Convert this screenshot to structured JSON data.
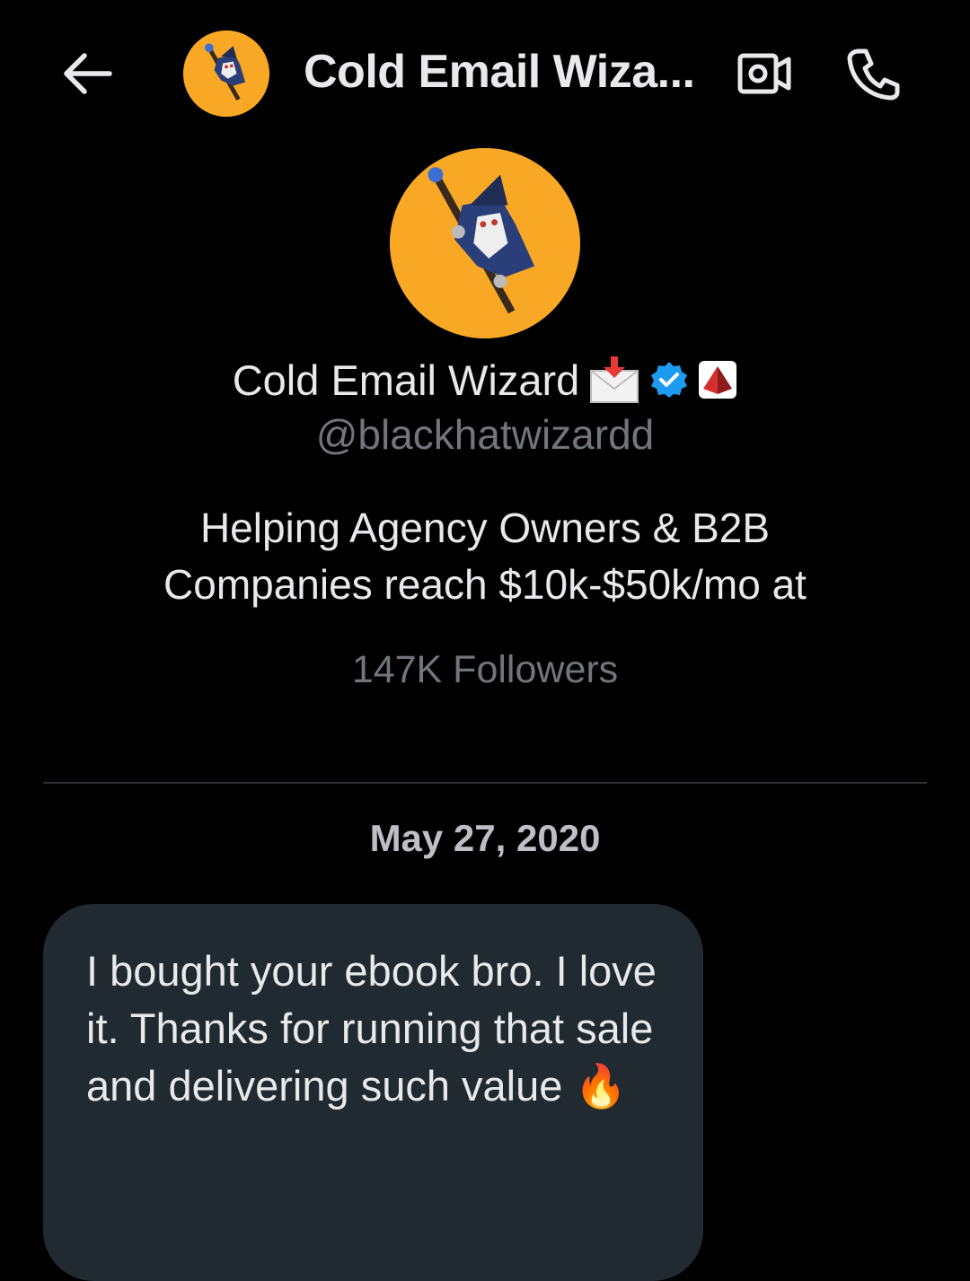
{
  "header": {
    "back_icon": "arrow-left-icon",
    "title": "Cold Email Wiza...",
    "video_icon": "video-call-icon",
    "phone_icon": "phone-icon"
  },
  "profile": {
    "name": "Cold Email Wizard",
    "badges": [
      "incoming-envelope-emoji",
      "verified-badge-icon",
      "red-pyramid-emoji"
    ],
    "handle": "@blackhatwizardd",
    "bio_line1": "Helping Agency Owners & B2B",
    "bio_line2": "Companies reach $10k-$50k/mo at",
    "followers": "147K Followers"
  },
  "conversation": {
    "date": "May 27, 2020",
    "messages": [
      {
        "text": "I bought your ebook bro. I love it. Thanks for running that sale and delivering such value 🔥"
      }
    ]
  },
  "colors": {
    "background": "#000000",
    "text_primary": "#e7e9ea",
    "text_secondary": "#71767b",
    "avatar_bg": "#f9a826",
    "verified_blue": "#1d9bf0",
    "bubble_bg": "#202a30",
    "divider": "#2f3336"
  }
}
